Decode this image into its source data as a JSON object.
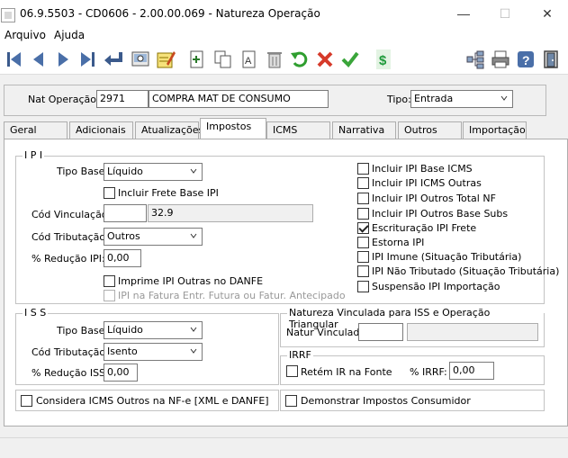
{
  "window": {
    "title": "06.9.5503 - CD0606 - 2.00.00.069 - Natureza Operação",
    "min": "—",
    "max": "☐",
    "close": "✕"
  },
  "menu": {
    "items": [
      "Arquivo",
      "Ajuda"
    ]
  },
  "header": {
    "nat_label": "Nat Operação:",
    "nat_code": "2971",
    "nat_desc": "COMPRA MAT DE CONSUMO",
    "tipo_label": "Tipo:",
    "tipo_value": "Entrada"
  },
  "tabs": [
    "Geral",
    "Adicionais",
    "Atualizações",
    "Impostos",
    "ICMS",
    "Narrativa",
    "Outros",
    "Importação"
  ],
  "active_tab": "Impostos",
  "ipi": {
    "legend": "I P I",
    "tipo_base_label": "Tipo Base:",
    "tipo_base_value": "Líquido",
    "incluir_frete_label": "Incluir Frete Base IPI",
    "cod_vinculacao_label": "Cód Vinculação:",
    "cod_vinculacao_value": "",
    "cod_vinculacao_desc": "32.9",
    "cod_tributacao_label": "Cód Tributação:",
    "cod_tributacao_value": "Outros",
    "reducao_label": "% Redução IPI:",
    "reducao_value": "0,00",
    "imprime_outras_label": "Imprime IPI Outras no DANFE",
    "fatura_entr_label": "IPI na Fatura Entr. Futura ou Fatur. Antecipado",
    "right_checks": [
      {
        "label": "Incluir IPI Base ICMS",
        "checked": false
      },
      {
        "label": "Incluir IPI ICMS Outras",
        "checked": false
      },
      {
        "label": "Incluir IPI Outros Total NF",
        "checked": false
      },
      {
        "label": "Incluir IPI Outros Base Subs",
        "checked": false
      },
      {
        "label": "Escrituração IPI Frete",
        "checked": true
      },
      {
        "label": "Estorna IPI",
        "checked": false
      },
      {
        "label": "IPI Imune (Situação Tributária)",
        "checked": false
      },
      {
        "label": "IPI Não Tributado (Situação Tributária)",
        "checked": false
      },
      {
        "label": "Suspensão IPI Importação",
        "checked": false
      }
    ]
  },
  "iss": {
    "legend": "I S S",
    "tipo_base_label": "Tipo Base:",
    "tipo_base_value": "Líquido",
    "cod_tributacao_label": "Cód Tributação:",
    "cod_tributacao_value": "Isento",
    "reducao_label": "% Redução ISS:",
    "reducao_value": "0,00"
  },
  "natureza_vinc": {
    "legend": "Natureza Vinculada para ISS e Operação Triangular",
    "label": "Natur Vinculada:",
    "value": "",
    "desc": ""
  },
  "irrf": {
    "legend": "IRRF",
    "retem_label": "Retém IR na Fonte",
    "pct_label": "% IRRF:",
    "pct_value": "0,00"
  },
  "considera_icms_label": "Considera ICMS Outros na NF-e [XML e DANFE]",
  "demonstrar_label": "Demonstrar Impostos Consumidor",
  "toolbar": {
    "buttons": [
      "first-icon",
      "prev-icon",
      "next-icon",
      "last-icon",
      "return-icon",
      "preview-icon",
      "edit-list-icon",
      "new-icon",
      "copy-icon",
      "text-icon",
      "delete-icon",
      "undo-icon",
      "cancel-icon",
      "confirm-icon",
      "currency-icon",
      "hierarchy-icon",
      "print-icon",
      "help-icon",
      "exit-icon"
    ]
  }
}
